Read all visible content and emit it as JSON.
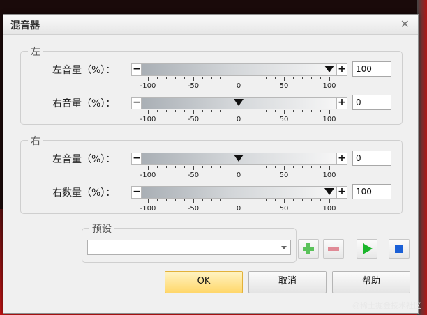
{
  "dialog": {
    "title": "混音器",
    "close_glyph": "✕"
  },
  "groups": {
    "left_group": {
      "label": "左",
      "rows": [
        {
          "label": "左音量（%）：",
          "value": "100",
          "thumb_value": 100
        },
        {
          "label": "右音量（%）：",
          "value": "0",
          "thumb_value": 0
        }
      ]
    },
    "right_group": {
      "label": "右",
      "rows": [
        {
          "label": "左音量（%）：",
          "value": "0",
          "thumb_value": 0
        },
        {
          "label": "右数量（%）：",
          "value": "100",
          "thumb_value": 100
        }
      ]
    }
  },
  "slider": {
    "minus_glyph": "−",
    "plus_glyph": "+",
    "range": [
      -100,
      100
    ],
    "tick_labels": [
      "-100",
      "-50",
      "0",
      "50",
      "100"
    ]
  },
  "preset": {
    "label": "预设",
    "selected": "",
    "add_icon": "plus-icon",
    "remove_icon": "minus-icon",
    "play_icon": "play-icon",
    "stop_icon": "stop-icon"
  },
  "buttons": {
    "ok": "OK",
    "cancel": "取消",
    "help": "帮助"
  },
  "watermark": "@稀土掘金技术社区",
  "colors": {
    "play": "#19b52a",
    "stop": "#1a5fd6",
    "add": "#5ac25a",
    "remove": "#e08a96",
    "ok_button": "#ffd76a"
  }
}
